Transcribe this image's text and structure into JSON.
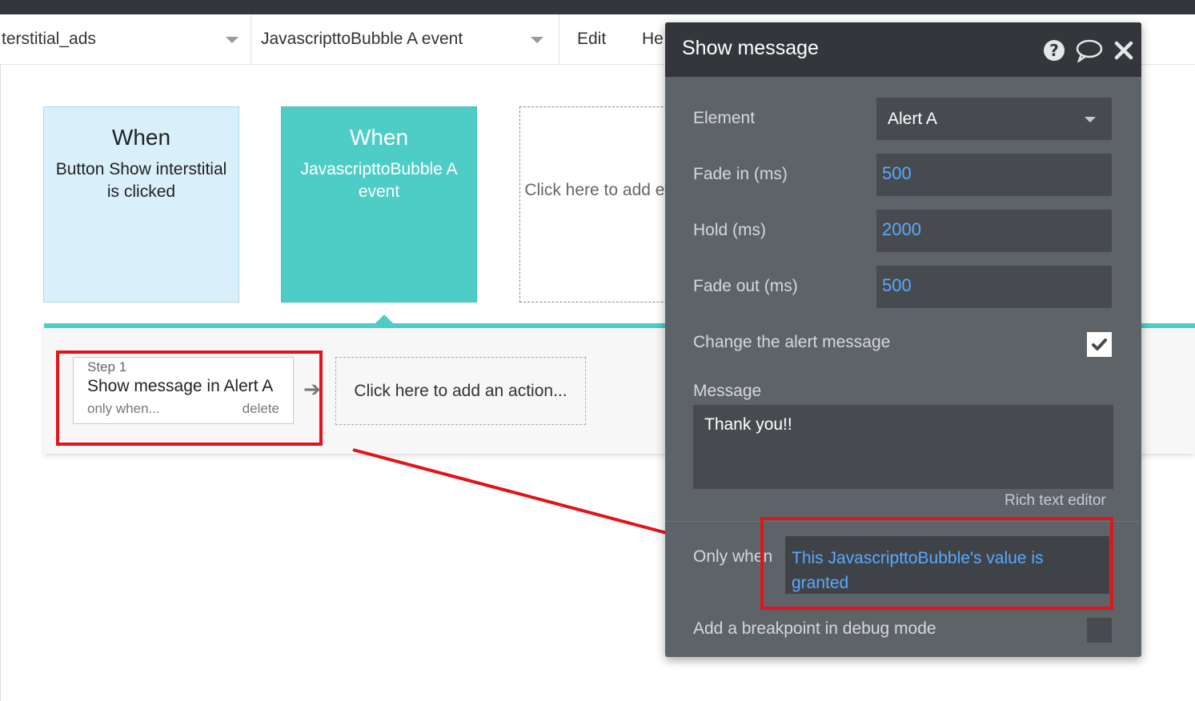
{
  "toolbar": {
    "page_dropdown": "terstitial_ads",
    "event_dropdown": "JavascripttoBubble A event",
    "menu_edit": "Edit",
    "menu_help": "He"
  },
  "events": [
    {
      "when": "When",
      "description": "Button Show interstitial is clicked"
    },
    {
      "when": "When",
      "description": "JavascripttoBubble A event"
    },
    {
      "add_text": "Click here to add event..."
    }
  ],
  "actions": {
    "step": {
      "number": "Step 1",
      "name": "Show message in Alert A",
      "only_when": "only when...",
      "delete": "delete"
    },
    "add_action": "Click here to add an action..."
  },
  "modal": {
    "title": "Show message",
    "element_label": "Element",
    "element_value": "Alert A",
    "fade_in_label": "Fade in (ms)",
    "fade_in_value": "500",
    "hold_label": "Hold (ms)",
    "hold_value": "2000",
    "fade_out_label": "Fade out (ms)",
    "fade_out_value": "500",
    "change_message_label": "Change the alert message",
    "change_message_checked": true,
    "message_label": "Message",
    "message_value": "Thank you!!",
    "rich_text_link": "Rich text editor",
    "only_when_label": "Only when",
    "only_when_value": "This JavascripttoBubble's value is granted",
    "breakpoint_label": "Add a breakpoint in debug mode",
    "breakpoint_checked": false
  },
  "icons": {
    "help": "question-circle-icon",
    "comment": "speech-bubble-icon",
    "close": "close-icon"
  },
  "colors": {
    "teal": "#4ecdc6",
    "annotation_red": "#e0141b",
    "link_blue": "#5aa9ff",
    "modal_bg": "#5e6368"
  }
}
